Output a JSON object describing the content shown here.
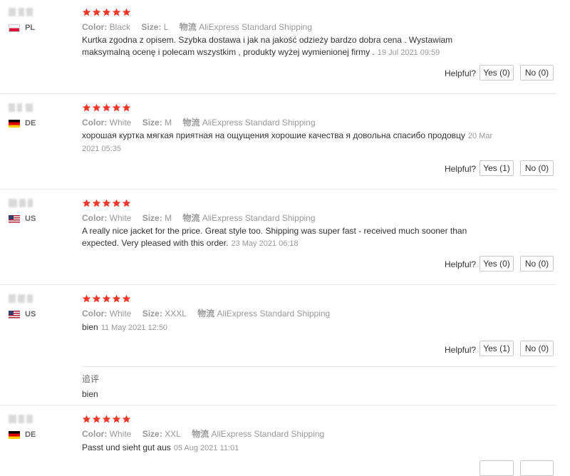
{
  "labels": {
    "color": "Color:",
    "size": "Size:",
    "shipping_label": "物流",
    "helpful": "Helpful?",
    "followup": "追评"
  },
  "star_color": "#f0392b",
  "reviews": [
    {
      "country": "PL",
      "flag": "pl-flag",
      "rating": 5,
      "color": "Black",
      "size": "L",
      "shipping": "AliExpress Standard Shipping",
      "text": "Kurtka zgodna z opisem. Szybka dostawa i jak na jakość odzieży bardzo dobra cena . Wystawiam maksymalną ocenę i polecam wszystkim , produkty wyżej wymienionej firmy .",
      "date": "19 Jul 2021 09:59",
      "yes": "Yes (0)",
      "no": "No (0)"
    },
    {
      "country": "DE",
      "flag": "de-flag",
      "rating": 5,
      "color": "White",
      "size": "M",
      "shipping": "AliExpress Standard Shipping",
      "text": "хорошая куртка мягкая приятная на ощущения хорошие качества я довольна спасибо продовцу",
      "date": "20 Mar 2021 05:35",
      "yes": "Yes (1)",
      "no": "No (0)"
    },
    {
      "country": "US",
      "flag": "us-flag",
      "rating": 5,
      "color": "White",
      "size": "M",
      "shipping": "AliExpress Standard Shipping",
      "text": "A really nice jacket for the price. Great style too. Shipping was super fast - received much sooner than expected. Very pleased with this order.",
      "date": "23 May 2021 06:18",
      "yes": "Yes (0)",
      "no": "No (0)"
    },
    {
      "country": "US",
      "flag": "us-flag",
      "rating": 5,
      "color": "White",
      "size": "XXXL",
      "shipping": "AliExpress Standard Shipping",
      "text": "bien",
      "date": "11 May 2021 12:50",
      "yes": "Yes (1)",
      "no": "No (0)",
      "followup_text": "bien"
    },
    {
      "country": "DE",
      "flag": "de-flag",
      "rating": 5,
      "color": "White",
      "size": "XXL",
      "shipping": "AliExpress Standard Shipping",
      "text": "Passt und sieht gut aus",
      "date": "05 Aug 2021 11:01"
    }
  ]
}
